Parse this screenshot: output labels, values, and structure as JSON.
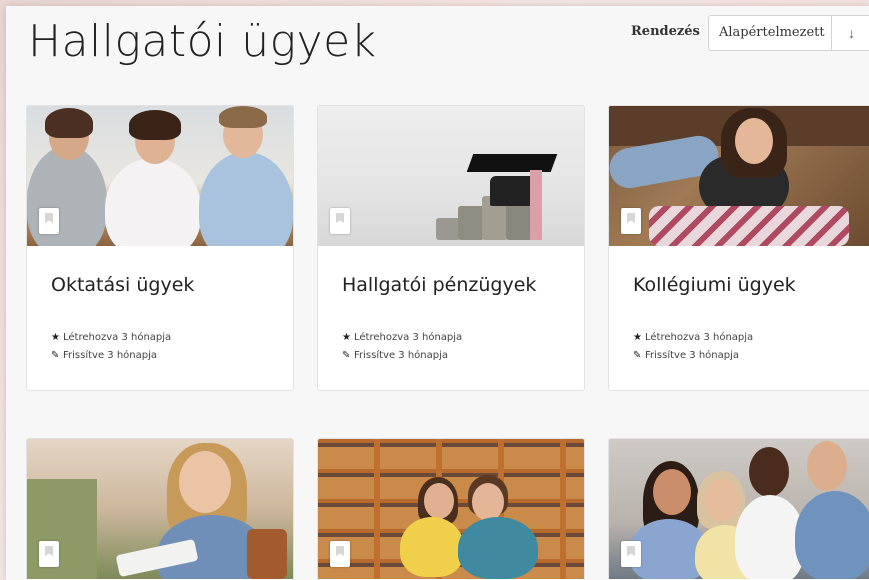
{
  "page": {
    "title": "Hallgatói ügyek"
  },
  "sort": {
    "label": "Rendezés",
    "selected": "Alapértelmezett",
    "direction_icon": "↓"
  },
  "cards": [
    {
      "title": "Oktatási ügyek",
      "created": "Létrehozva 3 hónapja",
      "updated": "Frissítve 3 hónapja"
    },
    {
      "title": "Hallgatói pénzügyek",
      "created": "Létrehozva 3 hónapja",
      "updated": "Frissítve 3 hónapja"
    },
    {
      "title": "Kollégiumi ügyek",
      "created": "Létrehozva 3 hónapja",
      "updated": "Frissítve 3 hónapja"
    },
    {
      "title": "",
      "created": "",
      "updated": ""
    },
    {
      "title": "",
      "created": "",
      "updated": ""
    },
    {
      "title": "",
      "created": "",
      "updated": ""
    }
  ],
  "icons": {
    "created": "star-icon",
    "updated": "pencil-icon",
    "bookmark": "bookmark-icon"
  }
}
